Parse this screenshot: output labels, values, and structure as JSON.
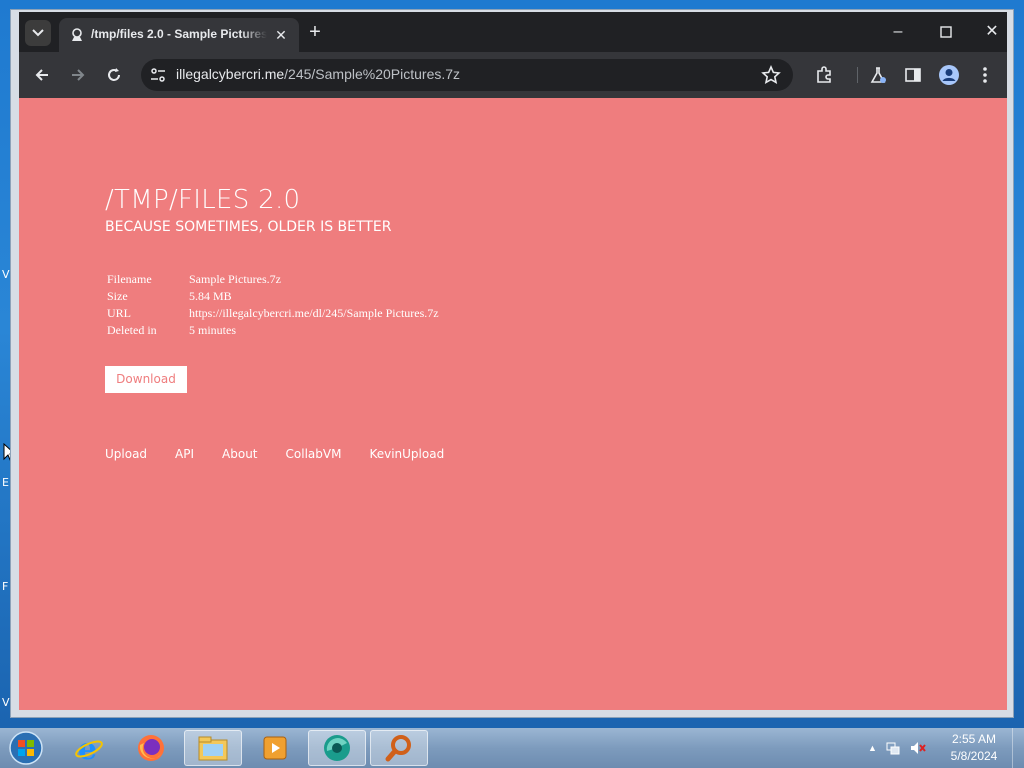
{
  "browser": {
    "tab_title": "/tmp/files 2.0 - Sample Pictures.7z",
    "url_host": "illegalcybercri.me",
    "url_path": "/245/Sample%20Pictures.7z"
  },
  "site": {
    "title": "/TMP/FILES 2.0",
    "subtitle": "BECAUSE SOMETIMES, OLDER IS BETTER",
    "file_info": [
      {
        "key": "Filename",
        "value": "Sample Pictures.7z"
      },
      {
        "key": "Size",
        "value": "5.84 MB"
      },
      {
        "key": "URL",
        "value": "https://illegalcybercri.me/dl/245/Sample Pictures.7z"
      },
      {
        "key": "Deleted in",
        "value": "5 minutes"
      }
    ],
    "download_label": "Download",
    "footer_links": [
      "Upload",
      "API",
      "About",
      "CollabVM",
      "KevinUpload"
    ],
    "page_bg": "#ef7d7e"
  },
  "desktop": {
    "edge_letters": [
      "V",
      "E",
      "F",
      "V"
    ]
  },
  "taskbar": {
    "apps": [
      "internet-explorer",
      "firefox",
      "file-explorer",
      "media-player",
      "browser-app",
      "search-app"
    ],
    "time": "2:55 AM",
    "date": "5/8/2024"
  }
}
